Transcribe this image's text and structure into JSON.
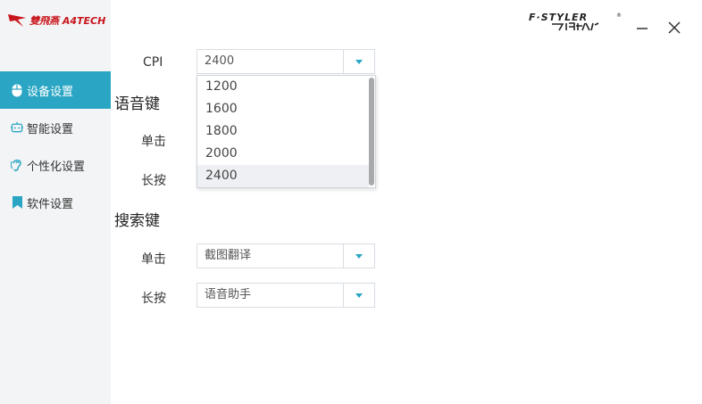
{
  "brand": {
    "left_logo_text": "雙飛燕 A4TECH",
    "right_logo_text": "F·STYLER 飞时代"
  },
  "window": {
    "minimize_symbol": "—",
    "close_symbol": "✕"
  },
  "sidebar": {
    "items": [
      {
        "label": "设备设置",
        "icon": "mouse-icon",
        "active": true
      },
      {
        "label": "智能设置",
        "icon": "robot-icon",
        "active": false
      },
      {
        "label": "个性化设置",
        "icon": "ear-icon",
        "active": false
      },
      {
        "label": "软件设置",
        "icon": "bookmark-icon",
        "active": false
      }
    ]
  },
  "cpi": {
    "label": "CPI",
    "value": "2400",
    "options": [
      "1200",
      "1600",
      "1800",
      "2000",
      "2400"
    ],
    "selected_option": "2400"
  },
  "voice_key": {
    "title": "语音键",
    "single_label": "单击",
    "long_label": "长按"
  },
  "search_key": {
    "title": "搜索键",
    "single_label": "单击",
    "single_value": "截图翻译",
    "long_label": "长按",
    "long_value": "语音助手"
  },
  "colors": {
    "accent": "#2aa6c4",
    "sidebar_bg": "#f3f4f6",
    "brand_red": "#c8161d"
  }
}
